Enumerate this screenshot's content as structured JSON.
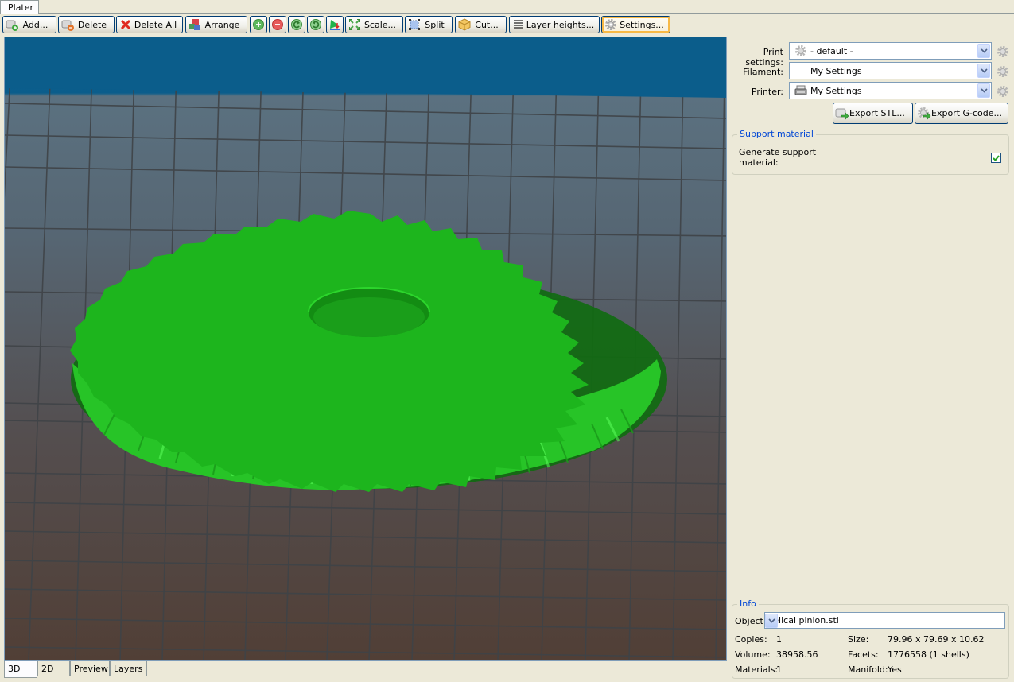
{
  "window": {
    "top_tab": "Plater"
  },
  "toolbar": {
    "buttons": [
      {
        "label": "Add...",
        "icon": "add-object-icon"
      },
      {
        "label": "Delete",
        "icon": "delete-object-icon"
      },
      {
        "label": "Delete All",
        "icon": "red-x-icon"
      },
      {
        "label": "Arrange",
        "icon": "arrange-icon"
      },
      {
        "label": "",
        "icon": "plus-circle-icon",
        "tooltip": "Increase copies"
      },
      {
        "label": "",
        "icon": "minus-circle-icon",
        "tooltip": "Decrease copies"
      },
      {
        "label": "",
        "icon": "rotate-left-icon"
      },
      {
        "label": "",
        "icon": "rotate-right-icon"
      },
      {
        "label": "",
        "icon": "place-on-face-icon"
      },
      {
        "label": "Scale...",
        "icon": "scale-icon"
      },
      {
        "label": "Split",
        "icon": "split-icon"
      },
      {
        "label": "Cut...",
        "icon": "cut-box-icon"
      },
      {
        "label": "Layer heights...",
        "icon": "layers-lines-icon"
      },
      {
        "label": "Settings...",
        "icon": "gear-icon",
        "active": true
      }
    ]
  },
  "viewport": {
    "mode": "3D",
    "object_color": "#1fc41f",
    "object_name": "Helical pinion.stl"
  },
  "view_tabs": [
    {
      "label": "3D",
      "active": true
    },
    {
      "label": "2D"
    },
    {
      "label": "Preview"
    },
    {
      "label": "Layers"
    }
  ],
  "presets": {
    "print_settings": {
      "label": "Print settings:",
      "value": "- default -",
      "icon": "gear-icon"
    },
    "filament": {
      "label": "Filament:",
      "value": "My Settings",
      "icon": ""
    },
    "printer": {
      "label": "Printer:",
      "value": "My Settings",
      "icon": "printer-icon"
    }
  },
  "export": {
    "stl_label": "Export STL...",
    "gcode_label": "Export G-code..."
  },
  "support": {
    "title": "Support material",
    "generate_label_line1": "Generate support",
    "generate_label_line2": "material:",
    "generate_checked": true
  },
  "info": {
    "title": "Info",
    "object_label": "Object:",
    "object_value": "Helical pinion.stl",
    "copies_label": "Copies:",
    "copies_value": "1",
    "volume_label": "Volume:",
    "volume_value": "38958.56",
    "materials_label": "Materials:",
    "materials_value": "1",
    "size_label": "Size:",
    "size_value": "79.96 x 79.69 x 10.62",
    "facets_label": "Facets:",
    "facets_value": "1776558 (1 shells)",
    "manifold_label": "Manifold:",
    "manifold_value": "Yes"
  }
}
